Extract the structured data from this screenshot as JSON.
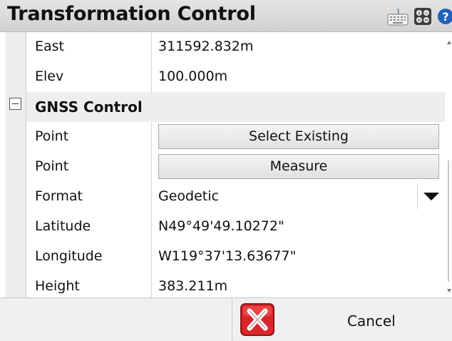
{
  "window": {
    "title": "Transformation Control"
  },
  "toolbar": {
    "icons": [
      "keyboard-icon",
      "calculator-icon",
      "help-icon"
    ]
  },
  "rows_top": [
    {
      "label": "East",
      "value": "311592.832m"
    },
    {
      "label": "Elev",
      "value": "100.000m"
    }
  ],
  "section": {
    "title": "GNSS Control",
    "expanded": true
  },
  "gnss": {
    "select_existing": {
      "label": "Point",
      "button": "Select Existing"
    },
    "measure": {
      "label": "Point",
      "button": "Measure"
    },
    "format": {
      "label": "Format",
      "value": "Geodetic"
    },
    "latitude": {
      "label": "Latitude",
      "value": "N49°49'49.10272\""
    },
    "longitude": {
      "label": "Longitude",
      "value": "W119°37'13.63677\""
    },
    "height": {
      "label": "Height",
      "value": "383.211m"
    }
  },
  "footer": {
    "cancel_label": "Cancel"
  },
  "colors": {
    "cancel_icon_red": "#d9262a",
    "help_icon_blue": "#1f5fbf"
  }
}
